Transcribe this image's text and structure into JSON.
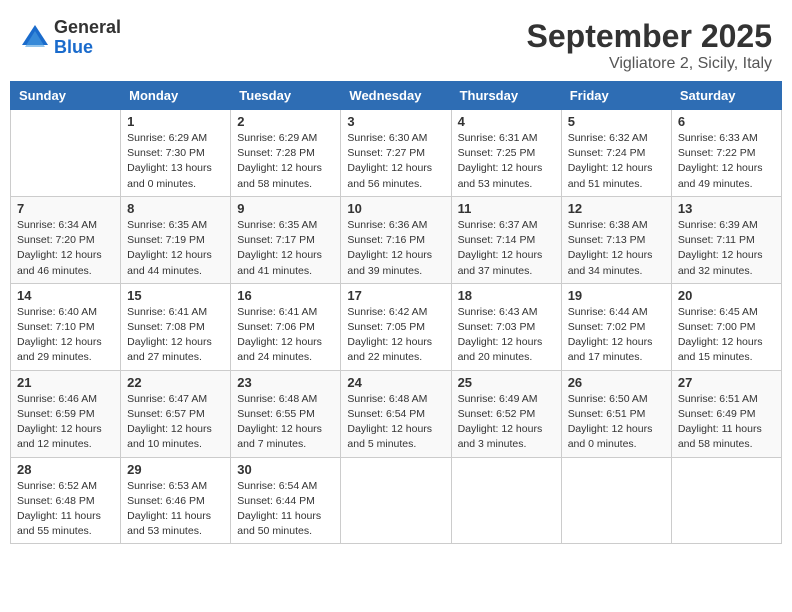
{
  "logo": {
    "general": "General",
    "blue": "Blue"
  },
  "title": "September 2025",
  "subtitle": "Vigliatore 2, Sicily, Italy",
  "weekdays": [
    "Sunday",
    "Monday",
    "Tuesday",
    "Wednesday",
    "Thursday",
    "Friday",
    "Saturday"
  ],
  "weeks": [
    [
      {
        "day": "",
        "info": ""
      },
      {
        "day": "1",
        "info": "Sunrise: 6:29 AM\nSunset: 7:30 PM\nDaylight: 13 hours\nand 0 minutes."
      },
      {
        "day": "2",
        "info": "Sunrise: 6:29 AM\nSunset: 7:28 PM\nDaylight: 12 hours\nand 58 minutes."
      },
      {
        "day": "3",
        "info": "Sunrise: 6:30 AM\nSunset: 7:27 PM\nDaylight: 12 hours\nand 56 minutes."
      },
      {
        "day": "4",
        "info": "Sunrise: 6:31 AM\nSunset: 7:25 PM\nDaylight: 12 hours\nand 53 minutes."
      },
      {
        "day": "5",
        "info": "Sunrise: 6:32 AM\nSunset: 7:24 PM\nDaylight: 12 hours\nand 51 minutes."
      },
      {
        "day": "6",
        "info": "Sunrise: 6:33 AM\nSunset: 7:22 PM\nDaylight: 12 hours\nand 49 minutes."
      }
    ],
    [
      {
        "day": "7",
        "info": "Sunrise: 6:34 AM\nSunset: 7:20 PM\nDaylight: 12 hours\nand 46 minutes."
      },
      {
        "day": "8",
        "info": "Sunrise: 6:35 AM\nSunset: 7:19 PM\nDaylight: 12 hours\nand 44 minutes."
      },
      {
        "day": "9",
        "info": "Sunrise: 6:35 AM\nSunset: 7:17 PM\nDaylight: 12 hours\nand 41 minutes."
      },
      {
        "day": "10",
        "info": "Sunrise: 6:36 AM\nSunset: 7:16 PM\nDaylight: 12 hours\nand 39 minutes."
      },
      {
        "day": "11",
        "info": "Sunrise: 6:37 AM\nSunset: 7:14 PM\nDaylight: 12 hours\nand 37 minutes."
      },
      {
        "day": "12",
        "info": "Sunrise: 6:38 AM\nSunset: 7:13 PM\nDaylight: 12 hours\nand 34 minutes."
      },
      {
        "day": "13",
        "info": "Sunrise: 6:39 AM\nSunset: 7:11 PM\nDaylight: 12 hours\nand 32 minutes."
      }
    ],
    [
      {
        "day": "14",
        "info": "Sunrise: 6:40 AM\nSunset: 7:10 PM\nDaylight: 12 hours\nand 29 minutes."
      },
      {
        "day": "15",
        "info": "Sunrise: 6:41 AM\nSunset: 7:08 PM\nDaylight: 12 hours\nand 27 minutes."
      },
      {
        "day": "16",
        "info": "Sunrise: 6:41 AM\nSunset: 7:06 PM\nDaylight: 12 hours\nand 24 minutes."
      },
      {
        "day": "17",
        "info": "Sunrise: 6:42 AM\nSunset: 7:05 PM\nDaylight: 12 hours\nand 22 minutes."
      },
      {
        "day": "18",
        "info": "Sunrise: 6:43 AM\nSunset: 7:03 PM\nDaylight: 12 hours\nand 20 minutes."
      },
      {
        "day": "19",
        "info": "Sunrise: 6:44 AM\nSunset: 7:02 PM\nDaylight: 12 hours\nand 17 minutes."
      },
      {
        "day": "20",
        "info": "Sunrise: 6:45 AM\nSunset: 7:00 PM\nDaylight: 12 hours\nand 15 minutes."
      }
    ],
    [
      {
        "day": "21",
        "info": "Sunrise: 6:46 AM\nSunset: 6:59 PM\nDaylight: 12 hours\nand 12 minutes."
      },
      {
        "day": "22",
        "info": "Sunrise: 6:47 AM\nSunset: 6:57 PM\nDaylight: 12 hours\nand 10 minutes."
      },
      {
        "day": "23",
        "info": "Sunrise: 6:48 AM\nSunset: 6:55 PM\nDaylight: 12 hours\nand 7 minutes."
      },
      {
        "day": "24",
        "info": "Sunrise: 6:48 AM\nSunset: 6:54 PM\nDaylight: 12 hours\nand 5 minutes."
      },
      {
        "day": "25",
        "info": "Sunrise: 6:49 AM\nSunset: 6:52 PM\nDaylight: 12 hours\nand 3 minutes."
      },
      {
        "day": "26",
        "info": "Sunrise: 6:50 AM\nSunset: 6:51 PM\nDaylight: 12 hours\nand 0 minutes."
      },
      {
        "day": "27",
        "info": "Sunrise: 6:51 AM\nSunset: 6:49 PM\nDaylight: 11 hours\nand 58 minutes."
      }
    ],
    [
      {
        "day": "28",
        "info": "Sunrise: 6:52 AM\nSunset: 6:48 PM\nDaylight: 11 hours\nand 55 minutes."
      },
      {
        "day": "29",
        "info": "Sunrise: 6:53 AM\nSunset: 6:46 PM\nDaylight: 11 hours\nand 53 minutes."
      },
      {
        "day": "30",
        "info": "Sunrise: 6:54 AM\nSunset: 6:44 PM\nDaylight: 11 hours\nand 50 minutes."
      },
      {
        "day": "",
        "info": ""
      },
      {
        "day": "",
        "info": ""
      },
      {
        "day": "",
        "info": ""
      },
      {
        "day": "",
        "info": ""
      }
    ]
  ]
}
